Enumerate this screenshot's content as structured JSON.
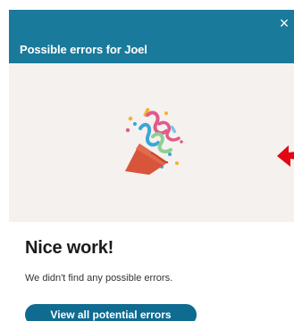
{
  "panel": {
    "title": "Possible errors for Joel",
    "close_icon": "close-icon"
  },
  "illustration": {
    "icon": "party-popper-icon"
  },
  "annotation": {
    "icon": "red-arrow-icon"
  },
  "result": {
    "title": "Nice work!",
    "message": "We didn't find any possible errors."
  },
  "actions": {
    "view_all_label": "View all potential errors"
  },
  "colors": {
    "header": "#1a7a9b",
    "hero_background": "#f4f1ee",
    "button": "#0f6b90",
    "arrow": "#e30613"
  }
}
